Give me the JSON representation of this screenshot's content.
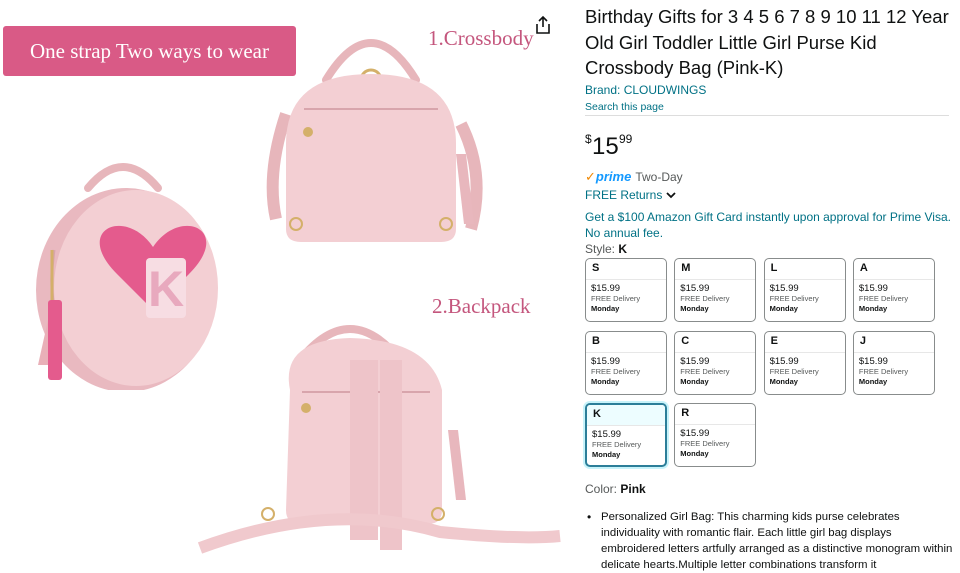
{
  "image_panel": {
    "banner_text": "One strap Two ways to wear",
    "crossbody_label": "1.Crossbody",
    "backpack_label": "2.Backpack",
    "share_icon": "share-icon",
    "monogram_letter": "K",
    "colors": {
      "bag_pink": "#f3cfd3",
      "bag_shadow": "#e4b4ba",
      "heart": "#e45b8d",
      "banner": "#d95a86",
      "gold": "#d4b06a"
    }
  },
  "product": {
    "title": "Birthday Gifts for 3 4 5 6 7 8 9 10 11 12 Year Old Girl Toddler Little Girl Purse Kid Crossbody Bag (Pink-K)",
    "brand": "Brand: CLOUDWINGS",
    "search_page": "Search this page",
    "price": {
      "symbol": "$",
      "whole": "15",
      "fraction": "99"
    },
    "prime": {
      "check": "✓",
      "word": "prime",
      "delivery": "Two-Day"
    },
    "returns": "FREE Returns",
    "promo": "Get a $100 Amazon Gift Card instantly upon approval for Prime Visa. No annual fee.",
    "style_label": "Style:",
    "style_value": "K",
    "styles": [
      {
        "letter": "S",
        "price": "$15.99",
        "delivery": "FREE Delivery",
        "day": "Monday"
      },
      {
        "letter": "M",
        "price": "$15.99",
        "delivery": "FREE Delivery",
        "day": "Monday"
      },
      {
        "letter": "L",
        "price": "$15.99",
        "delivery": "FREE Delivery",
        "day": "Monday"
      },
      {
        "letter": "A",
        "price": "$15.99",
        "delivery": "FREE Delivery",
        "day": "Monday"
      },
      {
        "letter": "B",
        "price": "$15.99",
        "delivery": "FREE Delivery",
        "day": "Monday"
      },
      {
        "letter": "C",
        "price": "$15.99",
        "delivery": "FREE Delivery",
        "day": "Monday"
      },
      {
        "letter": "E",
        "price": "$15.99",
        "delivery": "FREE Delivery",
        "day": "Monday"
      },
      {
        "letter": "J",
        "price": "$15.99",
        "delivery": "FREE Delivery",
        "day": "Monday"
      },
      {
        "letter": "K",
        "price": "$15.99",
        "delivery": "FREE Delivery",
        "day": "Monday"
      },
      {
        "letter": "R",
        "price": "$15.99",
        "delivery": "FREE Delivery",
        "day": "Monday"
      }
    ],
    "selected_style": "K",
    "color_label": "Color:",
    "color_value": "Pink",
    "bullets": [
      "Personalized Girl Bag: This charming kids purse celebrates individuality with romantic flair. Each little girl bag displays embroidered letters artfully arranged as a distinctive monogram within delicate hearts.Multiple letter combinations transform it"
    ],
    "accent_colors": {
      "link": "#007185",
      "prime_blue": "#1399ff",
      "prime_check": "#f08804",
      "selected_border": "#2c7e99"
    }
  }
}
